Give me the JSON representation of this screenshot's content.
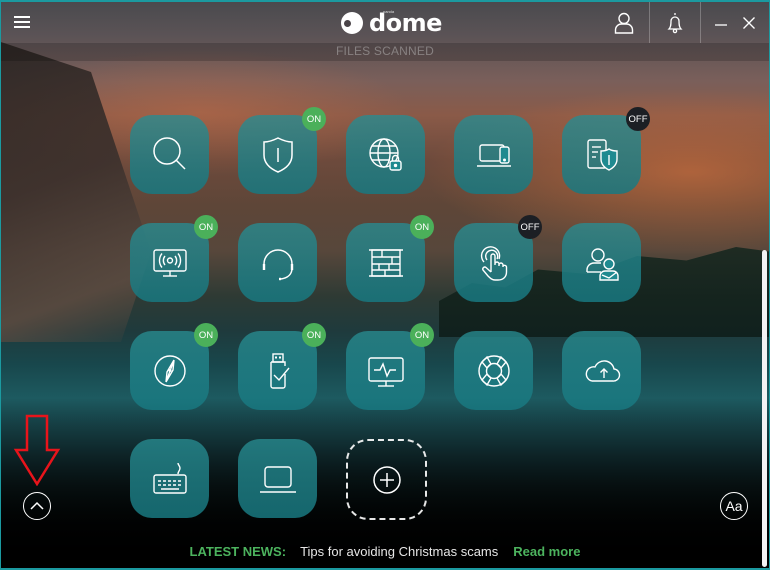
{
  "app": {
    "brand": "dome",
    "brand_sub": "panda",
    "files_scanned_label": "FILES SCANNED"
  },
  "titlebar": {
    "menu_icon": "hamburger-icon",
    "account_icon": "user-icon",
    "notifications_icon": "bell-icon",
    "minimize_label": "–",
    "close_label": "✕"
  },
  "tiles": [
    {
      "name": "antivirus-scan",
      "icon": "search-icon",
      "badge": null
    },
    {
      "name": "protection",
      "icon": "shield-icon",
      "badge": "ON"
    },
    {
      "name": "secure-browsing",
      "icon": "globe-lock-icon",
      "badge": null
    },
    {
      "name": "devices",
      "icon": "devices-icon",
      "badge": null
    },
    {
      "name": "data-shield",
      "icon": "document-shield-icon",
      "badge": "OFF"
    },
    {
      "name": "wifi-protection",
      "icon": "monitor-wifi-icon",
      "badge": "ON"
    },
    {
      "name": "support",
      "icon": "headset-icon",
      "badge": null
    },
    {
      "name": "firewall",
      "icon": "firewall-icon",
      "badge": "ON"
    },
    {
      "name": "application-control",
      "icon": "touch-icon",
      "badge": "OFF"
    },
    {
      "name": "parental-control",
      "icon": "user-check-icon",
      "badge": null
    },
    {
      "name": "safe-browsing",
      "icon": "compass-icon",
      "badge": "ON"
    },
    {
      "name": "usb-protection",
      "icon": "usb-check-icon",
      "badge": "ON"
    },
    {
      "name": "process-monitor",
      "icon": "monitor-pulse-icon",
      "badge": "ON"
    },
    {
      "name": "rescue-kit",
      "icon": "lifebuoy-icon",
      "badge": null
    },
    {
      "name": "cloud-backup",
      "icon": "cloud-upload-icon",
      "badge": null
    },
    {
      "name": "virtual-keyboard",
      "icon": "keyboard-icon",
      "badge": null
    },
    {
      "name": "my-devices",
      "icon": "laptop-icon",
      "badge": null
    }
  ],
  "add_tile": {
    "icon": "plus-circle-icon"
  },
  "bottom": {
    "expand_icon": "chevron-up-icon",
    "font_size_label": "Aa"
  },
  "news": {
    "label": "LATEST NEWS:",
    "title": "Tips for avoiding Christmas scams",
    "link": "Read more"
  },
  "colors": {
    "accent_green": "#4cb35e",
    "tile_teal": "#1f8a90",
    "badge_off": "#1c1f24",
    "annotation_red": "#e8141b"
  }
}
